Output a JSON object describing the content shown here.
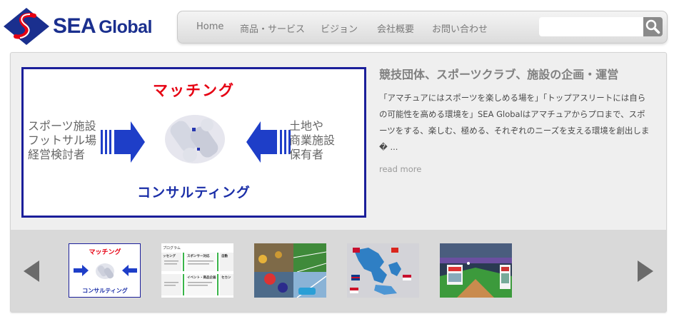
{
  "header": {
    "logo_sea": "SEA",
    "logo_global": "Global",
    "nav": [
      "Home",
      "商品・サービス",
      "ビジョン",
      "会社概要",
      "お問い合わせ"
    ],
    "search_value": ""
  },
  "featured": {
    "image_top": "マッチング",
    "image_bottom": "コンサルティング",
    "image_left": [
      "スポーツ施設",
      "フットサル場",
      "経営検討者"
    ],
    "image_right": [
      "土地や",
      "商業施設",
      "保有者"
    ]
  },
  "post": {
    "title": "競技団体、スポーツクラブ、施設の企画・運営",
    "excerpt": "「アマチュアにはスポーツを楽しめる場を」「トップアスリートには自らの可能性を高める環境を」SEA Globalはアマチュアからプロまで、スポーツをする、楽しむ、極める、それぞれのニーズを支える環境を創出しま� ...",
    "read_more": "read more"
  },
  "carousel": {
    "thumb1": {
      "top": "マッチング",
      "bottom": "コンサルティング"
    },
    "thumb2": {
      "lines": [
        "プログラム",
        "ッセング",
        "スポンサー対応",
        "自動",
        "イベント・商品企画",
        "セカン"
      ]
    }
  },
  "colors": {
    "brand_blue": "#1a2f8e",
    "brand_red": "#e60012",
    "arrow_blue": "#1e3ec8",
    "nav_text": "#7a7a7a",
    "carousel_bg": "#d9d9d9"
  },
  "icons": {
    "search": "magnifier-icon",
    "prev": "triangle-left-icon",
    "next": "triangle-right-icon"
  }
}
